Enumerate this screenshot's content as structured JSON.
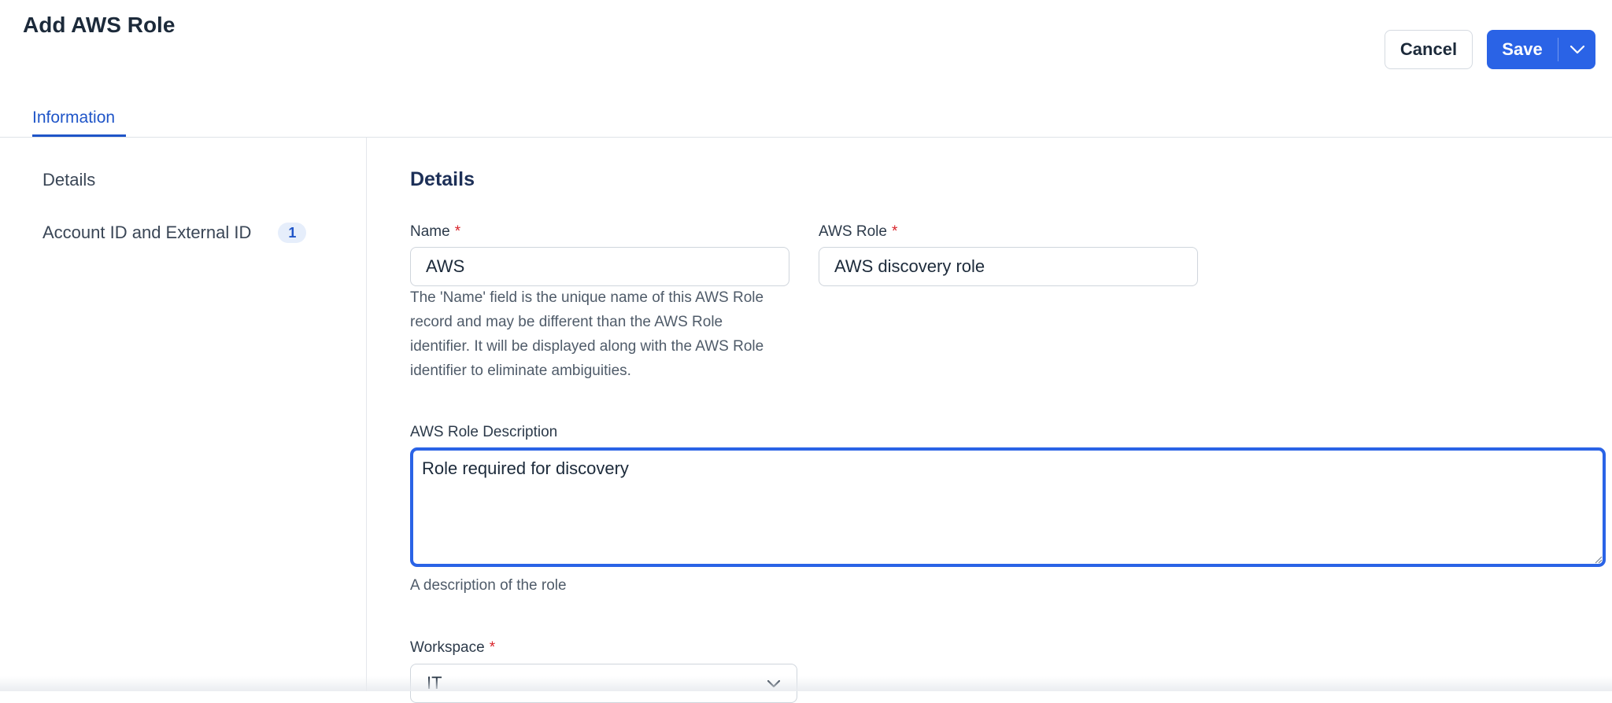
{
  "header": {
    "title": "Add AWS Role",
    "cancel_label": "Cancel",
    "save_label": "Save"
  },
  "tabs": [
    {
      "label": "Information",
      "active": true
    }
  ],
  "sidebar": {
    "items": [
      {
        "label": "Details"
      },
      {
        "label": "Account ID and External ID",
        "badge": "1"
      }
    ]
  },
  "form": {
    "section_title": "Details",
    "required_marker": "*",
    "name": {
      "label": "Name",
      "value": "AWS",
      "help_lines": [
        "The 'Name' field is the unique name of this AWS Role",
        "record and may be different than the AWS Role",
        "identifier. It will be displayed along with the AWS Role",
        "identifier to eliminate ambiguities."
      ]
    },
    "aws_role": {
      "label": "AWS Role",
      "value": "AWS discovery role"
    },
    "description": {
      "label": "AWS Role Description",
      "value": "Role required for discovery",
      "help": "A description of the role"
    },
    "workspace": {
      "label": "Workspace",
      "value": "IT"
    }
  },
  "colors": {
    "primary": "#2a63e6",
    "tab_active": "#1f55c8",
    "required": "#d8232a",
    "heading": "#1c2f57"
  },
  "icons": {
    "save_dropdown": "chevron-down-icon",
    "workspace_dropdown": "chevron-down-icon"
  }
}
